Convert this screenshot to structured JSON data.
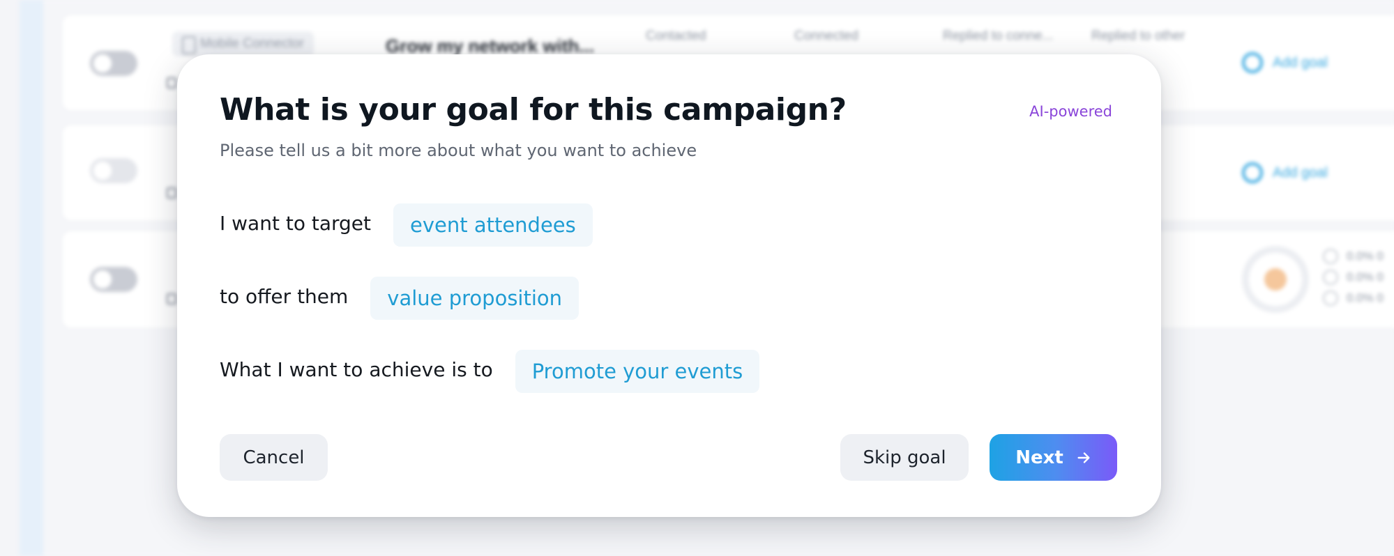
{
  "background": {
    "rows": [
      {
        "tag": "Mobile Connector",
        "campaign_name": "Grow my network with...",
        "columns": [
          "Contacted",
          "Connected",
          "Replied to conne...",
          "Replied to other"
        ],
        "action": "Add goal"
      },
      {
        "action": "Add goal"
      },
      {
        "stats": [
          "0.0% 0",
          "0.0% 0",
          "0.0% 0"
        ]
      }
    ]
  },
  "modal": {
    "title": "What is your goal for this campaign?",
    "badge": "AI-powered",
    "subtitle": "Please tell us a bit more about what you want to achieve",
    "goals": [
      {
        "label": "I want to target",
        "value": "event attendees"
      },
      {
        "label": "to offer them",
        "value": "value proposition"
      },
      {
        "label": "What I want to achieve is to",
        "value": "Promote your events"
      }
    ],
    "buttons": {
      "cancel": "Cancel",
      "skip": "Skip goal",
      "next": "Next"
    }
  },
  "icons": {
    "next_button": "arrow-right-icon",
    "add_goal": "target-icon",
    "campaign_date": "calendar-icon",
    "tag": "phone-icon"
  },
  "colors": {
    "accent_blue": "#1f9cd3",
    "ai_purple": "#8a45d9",
    "next_gradient": [
      "#1ea2e4",
      "#7a5af8"
    ],
    "chip_bg": "#f1f7fb"
  }
}
